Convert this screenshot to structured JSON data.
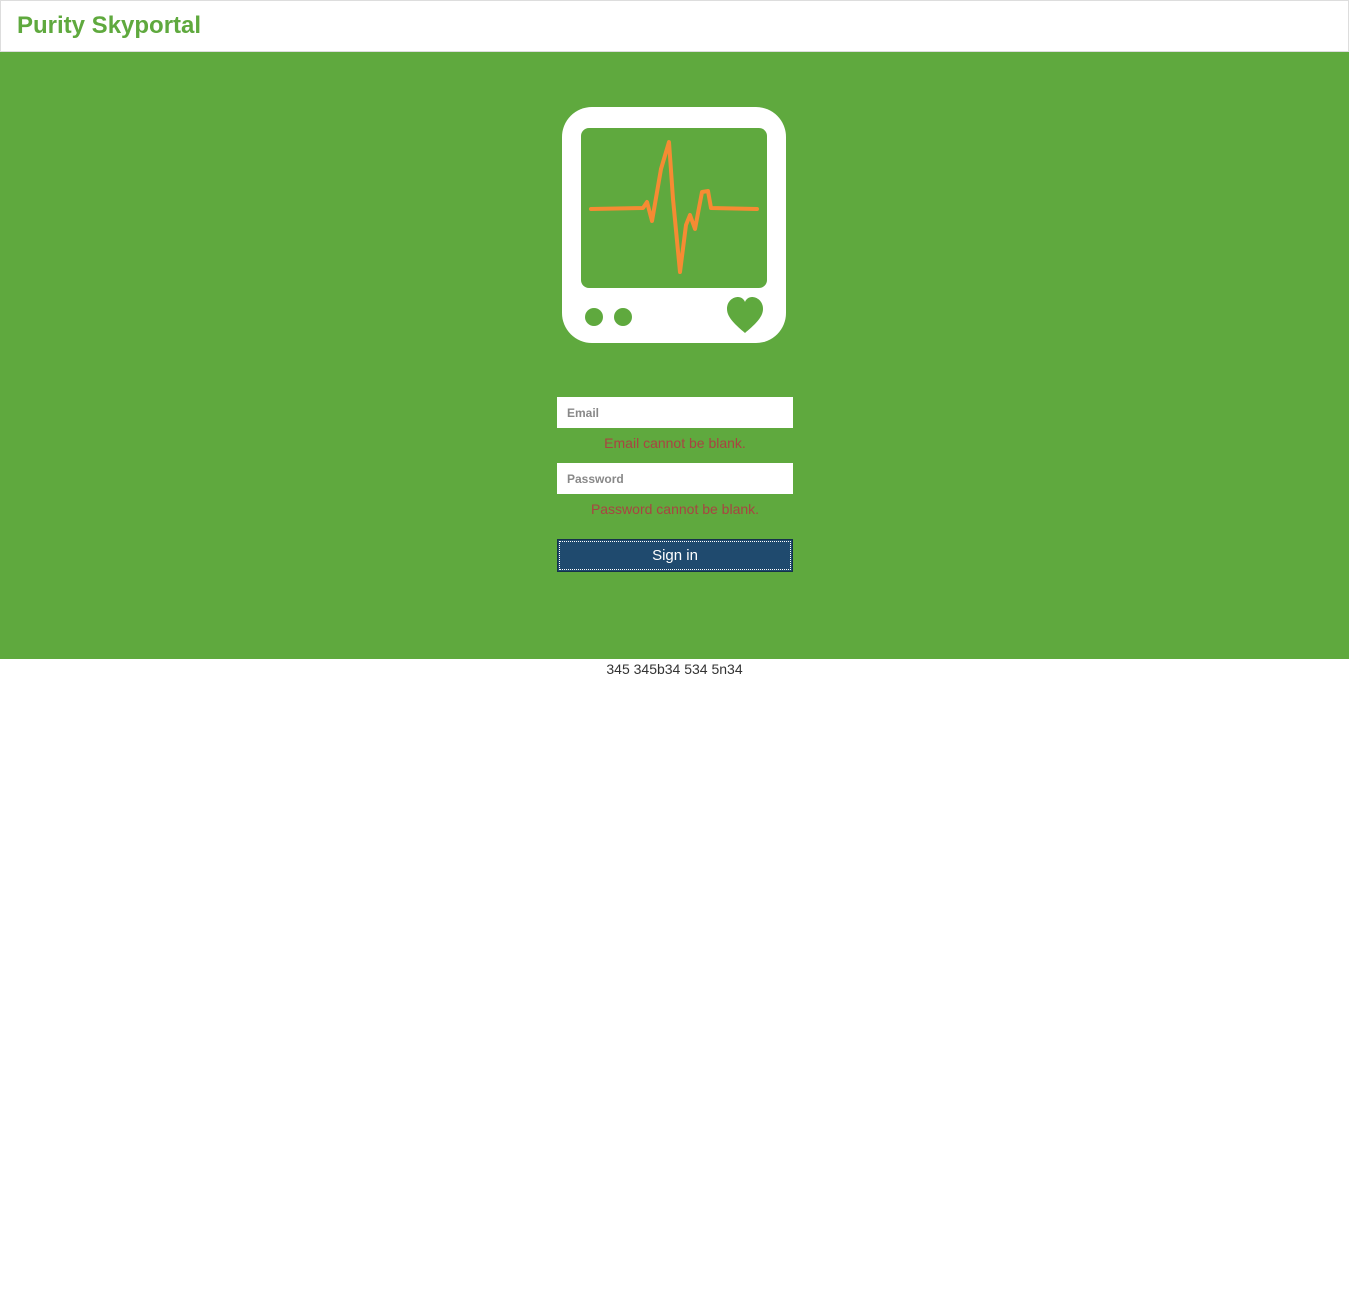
{
  "header": {
    "brand": "Purity Skyportal"
  },
  "colors": {
    "brand_green": "#5fa93e",
    "monitor_line": "#f68b33",
    "error_red": "#a94442",
    "button_navy": "#1f4a6e"
  },
  "logo": {
    "icon": "heart-monitor-icon"
  },
  "login": {
    "email_placeholder": "Email",
    "email_error": "Email cannot be blank.",
    "password_placeholder": "Password",
    "password_error": "Password cannot be blank.",
    "signin_label": "Sign in"
  },
  "footer": {
    "text": "345 345b34 534 5n34"
  }
}
